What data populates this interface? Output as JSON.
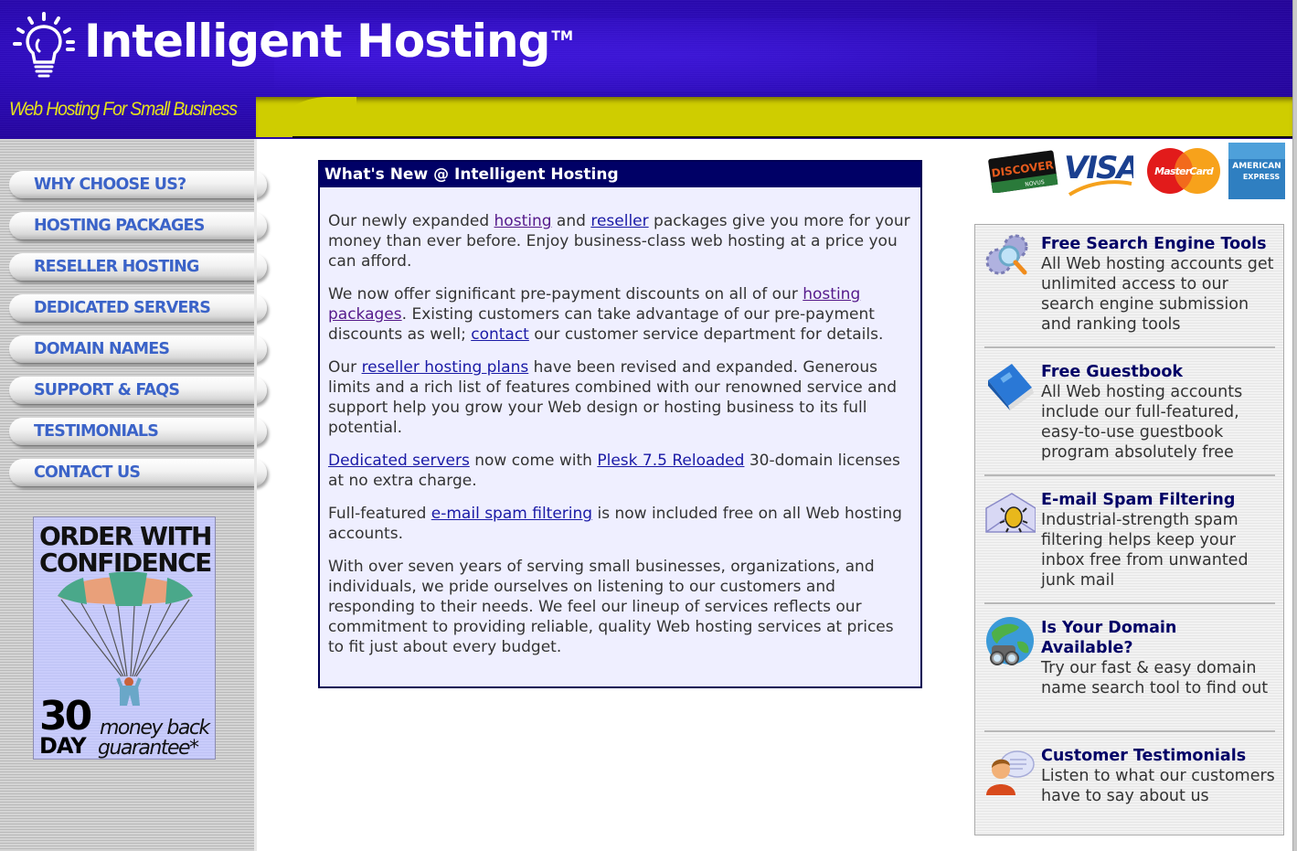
{
  "header": {
    "logo_text": "Intelligent Hosting",
    "trademark": "TM",
    "tagline": "Web Hosting For Small Business",
    "colors": {
      "banner": "#2a08b8",
      "band": "#cfcd00",
      "tagline": "#e6e21a"
    }
  },
  "sidebar": {
    "nav": [
      {
        "label": "WHY CHOOSE US?"
      },
      {
        "label": "HOSTING PACKAGES"
      },
      {
        "label": "RESELLER HOSTING"
      },
      {
        "label": "DEDICATED SERVERS"
      },
      {
        "label": "DOMAIN NAMES"
      },
      {
        "label": "SUPPORT & FAQS"
      },
      {
        "label": "TESTIMONIALS"
      },
      {
        "label": "CONTACT US"
      }
    ],
    "nav_text_color": "#3b63c8",
    "promo": {
      "title_line1": "ORDER WITH",
      "title_line2": "CONFIDENCE",
      "number": "30",
      "unit": "DAY",
      "line1": "money back",
      "line2": "guarantee*"
    }
  },
  "news": {
    "title": "What's New @ Intelligent Hosting",
    "p1": {
      "t1": "Our newly expanded ",
      "l1": "hosting",
      "t2": " and ",
      "l2": "reseller",
      "t3": " packages give you more for your money than ever before. Enjoy business-class web hosting at a price you can afford."
    },
    "p2": {
      "t1": "We now offer significant pre-payment discounts on all of our ",
      "l1": "hosting packages",
      "t2": ". Existing customers can take advantage of our pre-payment discounts as well; ",
      "l2": "contact",
      "t3": " our customer service department for details."
    },
    "p3": {
      "t1": "Our ",
      "l1": "reseller hosting plans",
      "t2": " have been revised and expanded. Generous limits and a rich list of features combined with our renowned service and support help you grow your Web design or hosting business to its full potential."
    },
    "p4": {
      "l1": "Dedicated servers",
      "t1": " now come with ",
      "l2": "Plesk 7.5 Reloaded",
      "t2": " 30-domain licenses at no extra charge."
    },
    "p5": {
      "t1": "Full-featured ",
      "l1": "e-mail spam filtering",
      "t2": " is now included free on all Web hosting accounts."
    },
    "p6": {
      "t1": "With over seven years of serving small businesses, organizations, and individuals, we pride ourselves on listening to our customers and responding to their needs. We feel our lineup of services reflects our commitment to providing reliable, quality Web hosting services at prices to fit just about every budget."
    }
  },
  "payment_cards": [
    {
      "name": "DISCOVER",
      "sub": "NOVUS"
    },
    {
      "name": "VISA"
    },
    {
      "name": "MasterCard"
    },
    {
      "name": "AMERICAN",
      "sub": "EXPRESS"
    }
  ],
  "features": [
    {
      "icon": "gears-magnifier-icon",
      "title": "Free Search Engine Tools",
      "desc": "All Web hosting accounts get unlimited access to our search engine submission and ranking tools"
    },
    {
      "icon": "book-icon",
      "title": "Free Guestbook",
      "desc": "All Web hosting accounts include our full-featured, easy-to-use guestbook program absolutely free"
    },
    {
      "icon": "envelope-bug-icon",
      "title": "E-mail Spam Filtering",
      "desc": "Industrial-strength spam filtering helps keep your inbox free from unwanted junk mail"
    },
    {
      "icon": "globe-binoculars-icon",
      "title": "Is Your Domain Available?",
      "desc": "Try our fast & easy domain name search tool to find out"
    },
    {
      "icon": "person-speech-icon",
      "title": "Customer Testimonials",
      "desc": "Listen to what our customers have to say about us"
    }
  ]
}
